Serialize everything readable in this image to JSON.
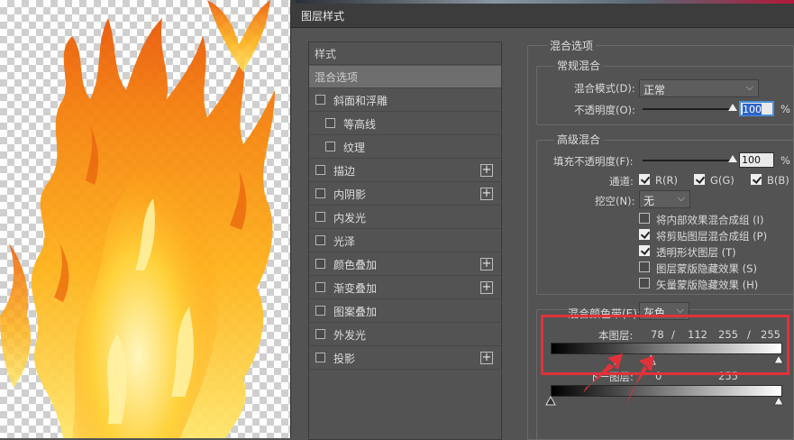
{
  "dialog": {
    "title": "图层样式"
  },
  "style_list": {
    "items": [
      {
        "label": "样式",
        "checkbox": false,
        "indent": 0,
        "plus": false,
        "selected": false,
        "header": true
      },
      {
        "label": "混合选项",
        "checkbox": false,
        "indent": 0,
        "plus": false,
        "selected": true,
        "header": true
      },
      {
        "label": "斜面和浮雕",
        "checkbox": true,
        "indent": 0,
        "plus": false
      },
      {
        "label": "等高线",
        "checkbox": true,
        "indent": 1,
        "plus": false
      },
      {
        "label": "纹理",
        "checkbox": true,
        "indent": 1,
        "plus": false
      },
      {
        "label": "描边",
        "checkbox": true,
        "indent": 0,
        "plus": true
      },
      {
        "label": "内阴影",
        "checkbox": true,
        "indent": 0,
        "plus": true
      },
      {
        "label": "内发光",
        "checkbox": true,
        "indent": 0,
        "plus": false
      },
      {
        "label": "光泽",
        "checkbox": true,
        "indent": 0,
        "plus": false
      },
      {
        "label": "颜色叠加",
        "checkbox": true,
        "indent": 0,
        "plus": true
      },
      {
        "label": "渐变叠加",
        "checkbox": true,
        "indent": 0,
        "plus": true
      },
      {
        "label": "图案叠加",
        "checkbox": true,
        "indent": 0,
        "plus": false
      },
      {
        "label": "外发光",
        "checkbox": true,
        "indent": 0,
        "plus": false
      },
      {
        "label": "投影",
        "checkbox": true,
        "indent": 0,
        "plus": true
      }
    ]
  },
  "blending": {
    "section_title": "混合选项",
    "general": {
      "title": "常规混合",
      "mode_label": "混合模式(D):",
      "mode_value": "正常",
      "opacity_label": "不透明度(O):",
      "opacity_value": "100",
      "opacity_unit": "%",
      "opacity_level": 1.0
    },
    "advanced": {
      "title": "高级混合",
      "fill_label": "填充不透明度(F):",
      "fill_value": "100",
      "fill_unit": "%",
      "fill_level": 1.0,
      "channels_label": "通道:",
      "channel_r": "R(R)",
      "channel_g": "G(G)",
      "channel_b": "B(B)",
      "knockout_label": "挖空(N):",
      "knockout_value": "无",
      "options": [
        {
          "label": "将内部效果混合成组 (I)",
          "checked": false
        },
        {
          "label": "将剪贴图层混合成组 (P)",
          "checked": true
        },
        {
          "label": "透明形状图层 (T)",
          "checked": true
        },
        {
          "label": "图层蒙版隐藏效果 (S)",
          "checked": false
        },
        {
          "label": "矢量蒙版隐藏效果 (H)",
          "checked": false
        }
      ]
    },
    "blend_if": {
      "label": "混合颜色带(E):",
      "value": "灰色",
      "this_layer_label": "本图层:",
      "this_layer_values": [
        "78",
        "/",
        "112",
        "255",
        "/",
        "255"
      ],
      "underlying_label": "下一图层:",
      "underlying_values": [
        "0",
        "255"
      ]
    }
  }
}
